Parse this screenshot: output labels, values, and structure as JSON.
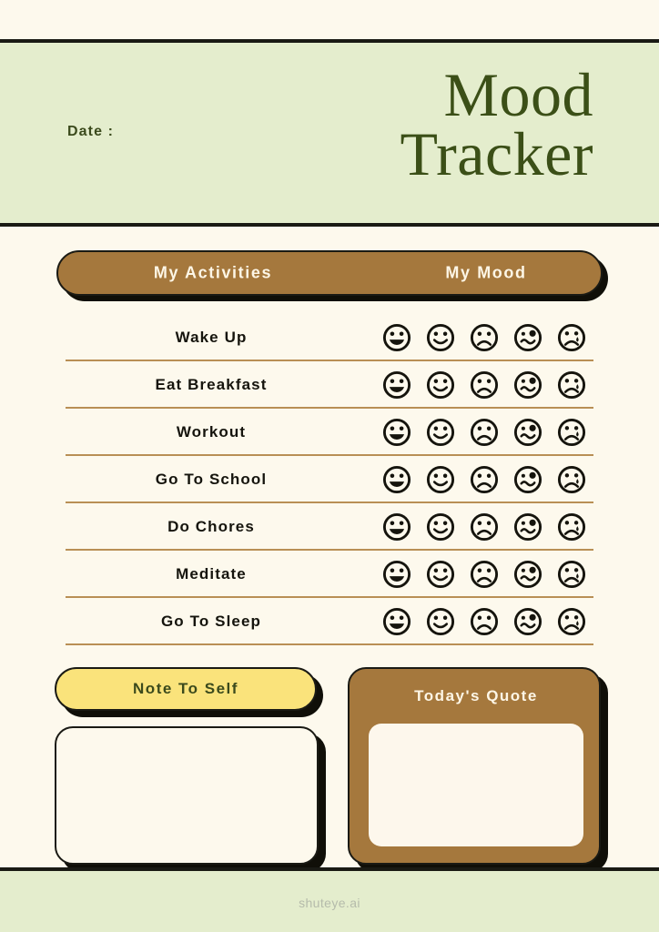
{
  "header": {
    "date_label": "Date :",
    "title_lines": [
      "Mood",
      "Tracker"
    ],
    "band_color": "#e4edcd",
    "title_color": "#3b4f17"
  },
  "table": {
    "columns": [
      "My Activities",
      "My Mood"
    ],
    "header_bg": "#a5783d",
    "header_text_color": "#fdf6e6",
    "separator_color": "#b98f55",
    "rows": [
      {
        "activity": "Wake Up"
      },
      {
        "activity": "Eat Breakfast"
      },
      {
        "activity": "Workout"
      },
      {
        "activity": "Go To School"
      },
      {
        "activity": "Do Chores"
      },
      {
        "activity": "Meditate"
      },
      {
        "activity": "Go To Sleep"
      }
    ],
    "mood_options": [
      {
        "id": "very-happy",
        "label": "Very Happy"
      },
      {
        "id": "happy",
        "label": "Happy"
      },
      {
        "id": "sad",
        "label": "Sad"
      },
      {
        "id": "confused",
        "label": "Confused"
      },
      {
        "id": "crying",
        "label": "Crying"
      }
    ]
  },
  "note": {
    "title": "Note To Self",
    "title_bg": "#fae37b",
    "title_color": "#3b4a1c",
    "box_value": "",
    "box_placeholder": ""
  },
  "quote": {
    "title": "Today's Quote",
    "card_bg": "#a5783d",
    "title_color": "#fdf6e6",
    "box_value": "",
    "box_placeholder": ""
  },
  "footer": {
    "watermark": "shuteye.ai"
  },
  "page_bg": "#fdf9ed"
}
